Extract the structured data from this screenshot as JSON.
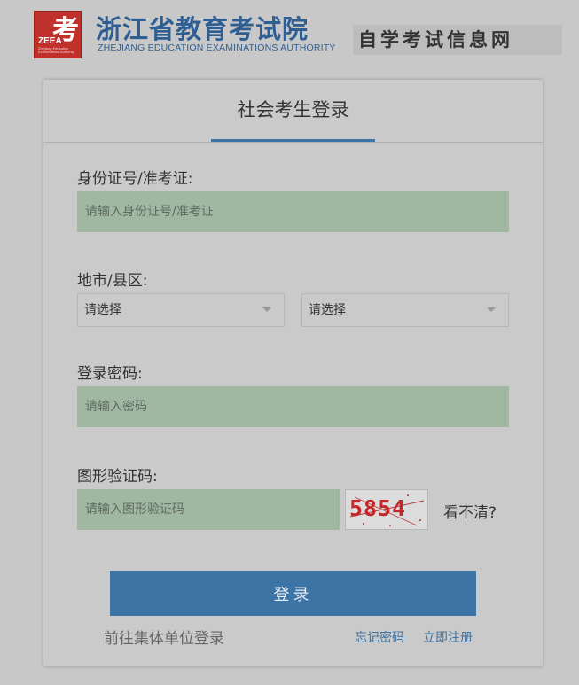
{
  "header": {
    "logo_glyph": "考",
    "logo_abbr": "ZEEA",
    "logo_tiny": "Zhejiang Education Examinations Authority",
    "org_name": "浙江省教育考试院",
    "org_en": "ZHEJIANG EDUCATION EXAMINATIONS AUTHORITY",
    "site_name": "自学考试信息网"
  },
  "form": {
    "title": "社会考生登录",
    "id_label": "身份证号/准考证:",
    "id_placeholder": "请输入身份证号/准考证",
    "region_label": "地市/县区:",
    "city_select": "请选择",
    "district_select": "请选择",
    "password_label": "登录密码:",
    "password_placeholder": "请输入密码",
    "captcha_label": "图形验证码:",
    "captcha_placeholder": "请输入图形验证码",
    "captcha_text": "5854",
    "refresh_label": "看不清?",
    "login_button": "登录",
    "group_login_link": "前往集体单位登录",
    "forgot_password_link": "忘记密码",
    "register_link": "立即注册"
  },
  "colors": {
    "accent": "#3d74a6",
    "input_bg": "#a0b7a2",
    "background": "#c8c8c8",
    "brand_red": "#c0312c"
  }
}
